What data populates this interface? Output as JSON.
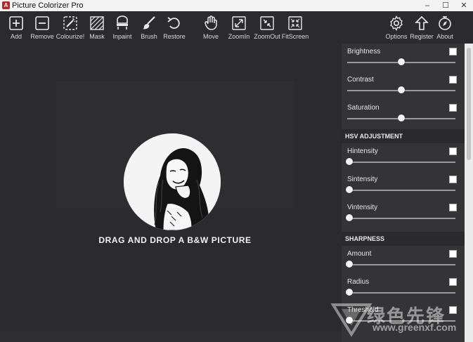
{
  "window": {
    "title": "Picture Colorizer Pro",
    "app_icon": "A",
    "controls": [
      "–",
      "☐",
      "✕"
    ]
  },
  "toolbar": {
    "left": [
      {
        "id": "add",
        "label": "Add",
        "icon": "plus-box-icon"
      },
      {
        "id": "remove",
        "label": "Remove",
        "icon": "minus-box-icon"
      },
      {
        "id": "colourize",
        "label": "Colourize!",
        "icon": "magic-wand-icon"
      },
      {
        "id": "mask",
        "label": "Mask",
        "icon": "mask-hatch-icon"
      },
      {
        "id": "inpaint",
        "label": "Inpaint",
        "icon": "inpaint-icon"
      },
      {
        "id": "brush",
        "label": "Brush",
        "icon": "brush-icon"
      },
      {
        "id": "restore",
        "label": "Restore",
        "icon": "restore-arrow-icon"
      },
      {
        "id": "move",
        "label": "Move",
        "icon": "hand-icon"
      },
      {
        "id": "zoomin",
        "label": "ZoomIn",
        "icon": "zoom-in-icon"
      },
      {
        "id": "zoomout",
        "label": "ZoomOut",
        "icon": "zoom-out-icon"
      },
      {
        "id": "fitscreen",
        "label": "FitScreen",
        "icon": "fit-screen-icon"
      }
    ],
    "right": [
      {
        "id": "options",
        "label": "Options",
        "icon": "gear-icon"
      },
      {
        "id": "register",
        "label": "Register",
        "icon": "upload-arrow-icon"
      },
      {
        "id": "about",
        "label": "About",
        "icon": "compass-icon"
      }
    ]
  },
  "canvas": {
    "drop_text": "DRAG AND DROP A B&W PICTURE"
  },
  "panel": {
    "basic": [
      {
        "label": "Brightness",
        "value": 0.5,
        "checked": false
      },
      {
        "label": "Contrast",
        "value": 0.5,
        "checked": false
      },
      {
        "label": "Saturation",
        "value": 0.5,
        "checked": false
      }
    ],
    "hsv_title": "HSV ADJUSTMENT",
    "hsv": [
      {
        "label": "Hintensity",
        "value": 0.0,
        "checked": false
      },
      {
        "label": "Sintensity",
        "value": 0.0,
        "checked": false
      },
      {
        "label": "Vintensity",
        "value": 0.0,
        "checked": false
      }
    ],
    "sharpness_title": "SHARPNESS",
    "sharpness": [
      {
        "label": "Amount",
        "value": 0.0,
        "checked": false
      },
      {
        "label": "Radius",
        "value": 0.0,
        "checked": false
      },
      {
        "label": "Threshold",
        "value": 0.0,
        "checked": false
      }
    ]
  },
  "watermark": {
    "text": "绿色先锋",
    "url": "www.greenxf.com"
  }
}
